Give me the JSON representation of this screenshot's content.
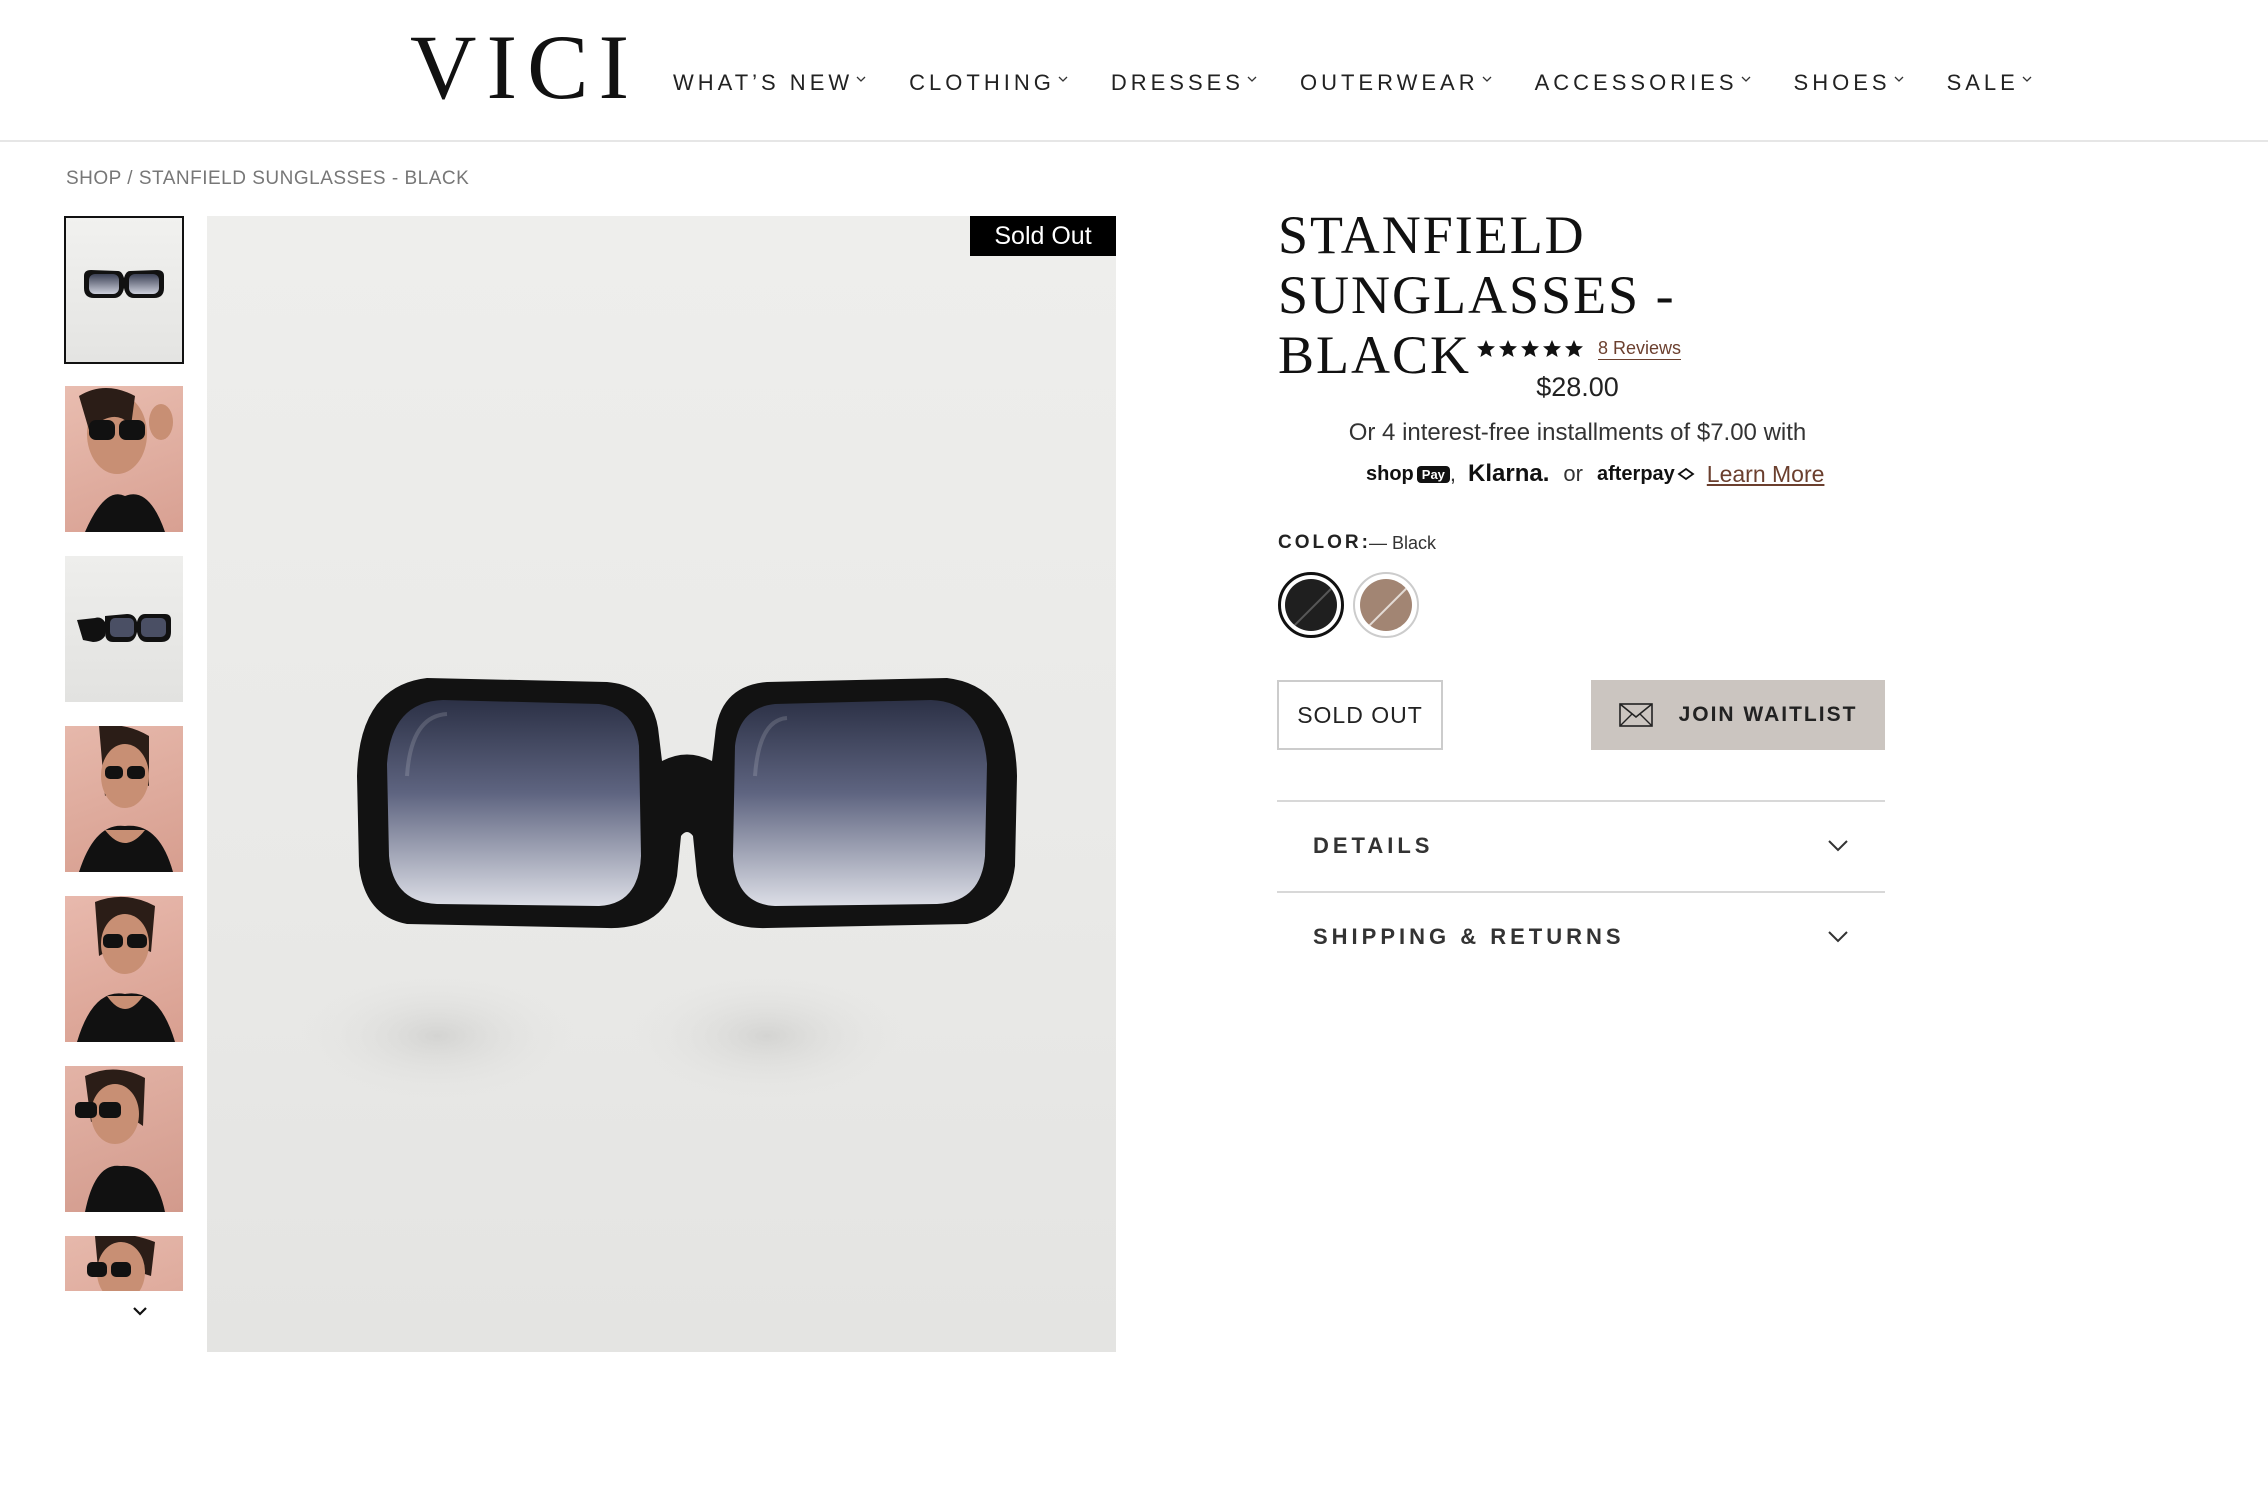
{
  "header": {
    "logo": "VICI",
    "nav": [
      {
        "label": "WHAT’S NEW"
      },
      {
        "label": "CLOTHING"
      },
      {
        "label": "DRESSES"
      },
      {
        "label": "OUTERWEAR"
      },
      {
        "label": "ACCESSORIES"
      },
      {
        "label": "SHOES"
      },
      {
        "label": "SALE"
      }
    ]
  },
  "breadcrumb": {
    "shop": "SHOP",
    "separator": " / ",
    "current": "STANFIELD SUNGLASSES - BLACK"
  },
  "gallery": {
    "badge": "Sold Out",
    "thumbnails": [
      {
        "icon": "product-sunglasses"
      },
      {
        "icon": "model-photo"
      },
      {
        "icon": "product-sunglasses-side"
      },
      {
        "icon": "model-photo"
      },
      {
        "icon": "model-photo"
      },
      {
        "icon": "model-photo"
      },
      {
        "icon": "model-photo"
      }
    ]
  },
  "product": {
    "title_line1": "STANFIELD",
    "title_line2": "SUNGLASSES - BLACK",
    "rating_stars": 5,
    "reviews": "8 Reviews",
    "price": "$28.00",
    "installments": "Or 4 interest-free installments of $7.00 with",
    "pay_shop": "shop",
    "pay_shop_box": "Pay",
    "pay_comma": ",",
    "pay_klarna": "Klarna.",
    "pay_or": "or",
    "pay_afterpay": "afterpay",
    "learn_more": "Learn More",
    "color_label": "COLOR:",
    "color_value": "— Black",
    "swatches": [
      {
        "name": "Black",
        "color": "#1f1f1f"
      },
      {
        "name": "Tan",
        "color": "#a28573"
      }
    ],
    "sold_out_button": "SOLD OUT",
    "waitlist_button": "JOIN WAITLIST",
    "accordions": [
      {
        "label": "DETAILS"
      },
      {
        "label": "SHIPPING & RETURNS"
      }
    ]
  },
  "colors": {
    "accent_link": "#6b3f2e",
    "waitlist_bg": "#cbc5c0",
    "badge_bg": "#000000"
  }
}
